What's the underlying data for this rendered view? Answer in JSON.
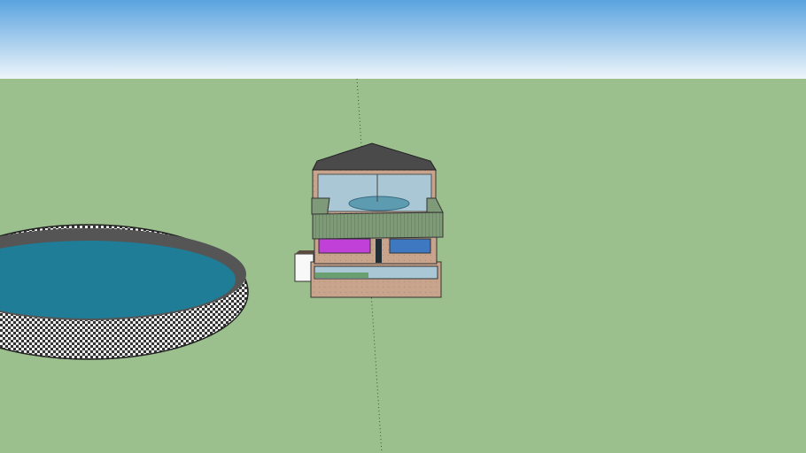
{
  "scene": {
    "colors": {
      "sky_top": "#5aa3df",
      "sky_bottom": "#eef5fa",
      "ground": "#9cbf8e",
      "water": "#1f7d98",
      "roof": "#4a4a4a",
      "brick": "#c9a48c",
      "glass": "#a9c7d4",
      "balcony": "#7f9a78",
      "purple": "#c040d8",
      "blue": "#3d78c0"
    }
  }
}
